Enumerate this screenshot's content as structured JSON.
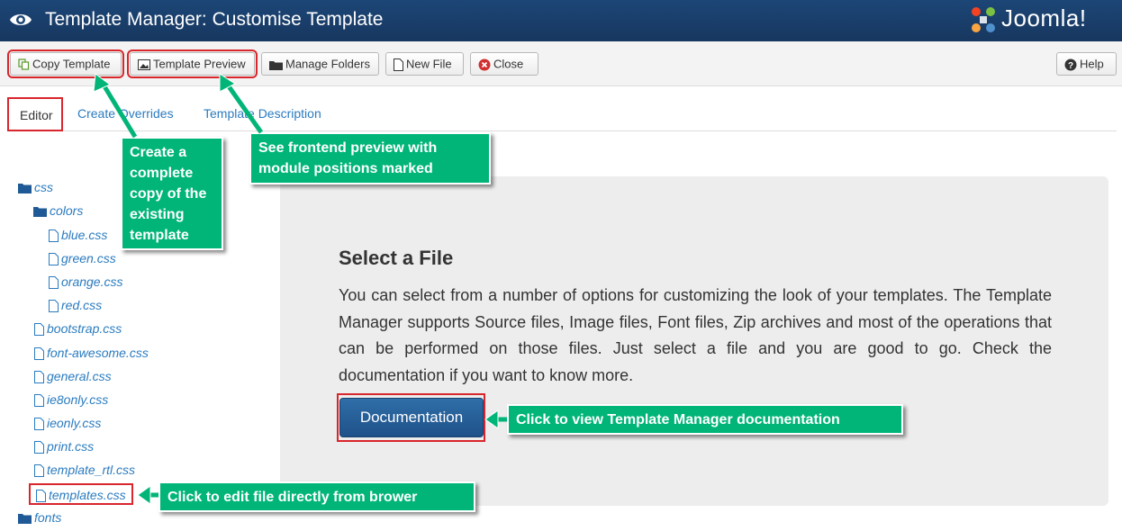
{
  "header": {
    "title": "Template Manager: Customise Template",
    "brand": "Joomla!",
    "bg_color": "#1c4677"
  },
  "toolbar": {
    "copy_template": "Copy Template",
    "template_preview": "Template Preview",
    "manage_folders": "Manage Folders",
    "new_file": "New File",
    "close": "Close",
    "help": "Help"
  },
  "tabs": {
    "editor": "Editor",
    "create_overrides": "Create Overrides",
    "template_description": "Template Description"
  },
  "tree": {
    "css": "css",
    "colors": "colors",
    "blue": "blue.css",
    "green": "green.css",
    "orange": "orange.css",
    "red": "red.css",
    "bootstrap": "bootstrap.css",
    "font_awesome": "font-awesome.css",
    "general": "general.css",
    "ie8only": "ie8only.css",
    "ieonly": "ieonly.css",
    "print": "print.css",
    "template_rtl": "template_rtl.css",
    "templates": "templates.css",
    "fonts": "fonts"
  },
  "main": {
    "heading": "Select a File",
    "description": "You can select from a number of options for customizing the look of your templates. The Template Manager supports Source files, Image files, Font files, Zip archives and most of the operations that can be performed on those files. Just select a file and you are good to go. Check the documentation if you want to know more.",
    "documentation_button": "Documentation"
  },
  "callouts": {
    "copy": "Create a complete copy of the existing template",
    "preview": "See frontend preview with module positions marked",
    "documentation": "Click to view Template Manager documentation",
    "edit": "Click to edit file directly from brower"
  },
  "colors": {
    "accent": "#2a7bbf",
    "callout": "#00b577",
    "highlight": "#d9262c"
  }
}
